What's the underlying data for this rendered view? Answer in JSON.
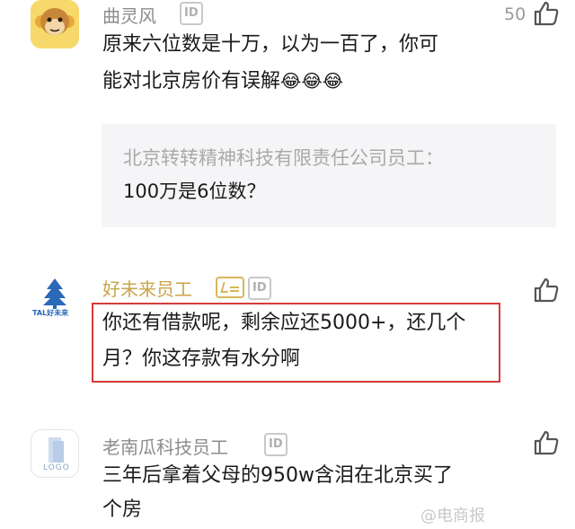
{
  "comments": [
    {
      "name": "曲灵风",
      "id_badge": "ID",
      "likes": "50",
      "text_line1": "原来六位数是十万，以为一百了，你可",
      "text_line2": "能对北京房价有误解",
      "emoji": "😂😂😂",
      "quote": {
        "name": "北京转转精神科技有限责任公司员工：",
        "text": "100万是6位数？"
      }
    },
    {
      "name": "好未来员工",
      "id_badge": "ID",
      "text_line1": "你还有借款呢，剩余应还5000+，还几个",
      "text_line2": "月？你这存款有水分啊",
      "avatar_logo": "TAL好未来"
    },
    {
      "name": "老南瓜科技员工",
      "id_badge": "ID",
      "text_line1": "三年后拿着父母的950w含泪在北京买了",
      "text_line2": "个房",
      "avatar_logo": "LOGO"
    }
  ],
  "watermark": "@电商报",
  "colors": {
    "highlight": "#d63a3a",
    "gold_name": "#c9a44a",
    "gray_name": "#8c8c8c"
  }
}
